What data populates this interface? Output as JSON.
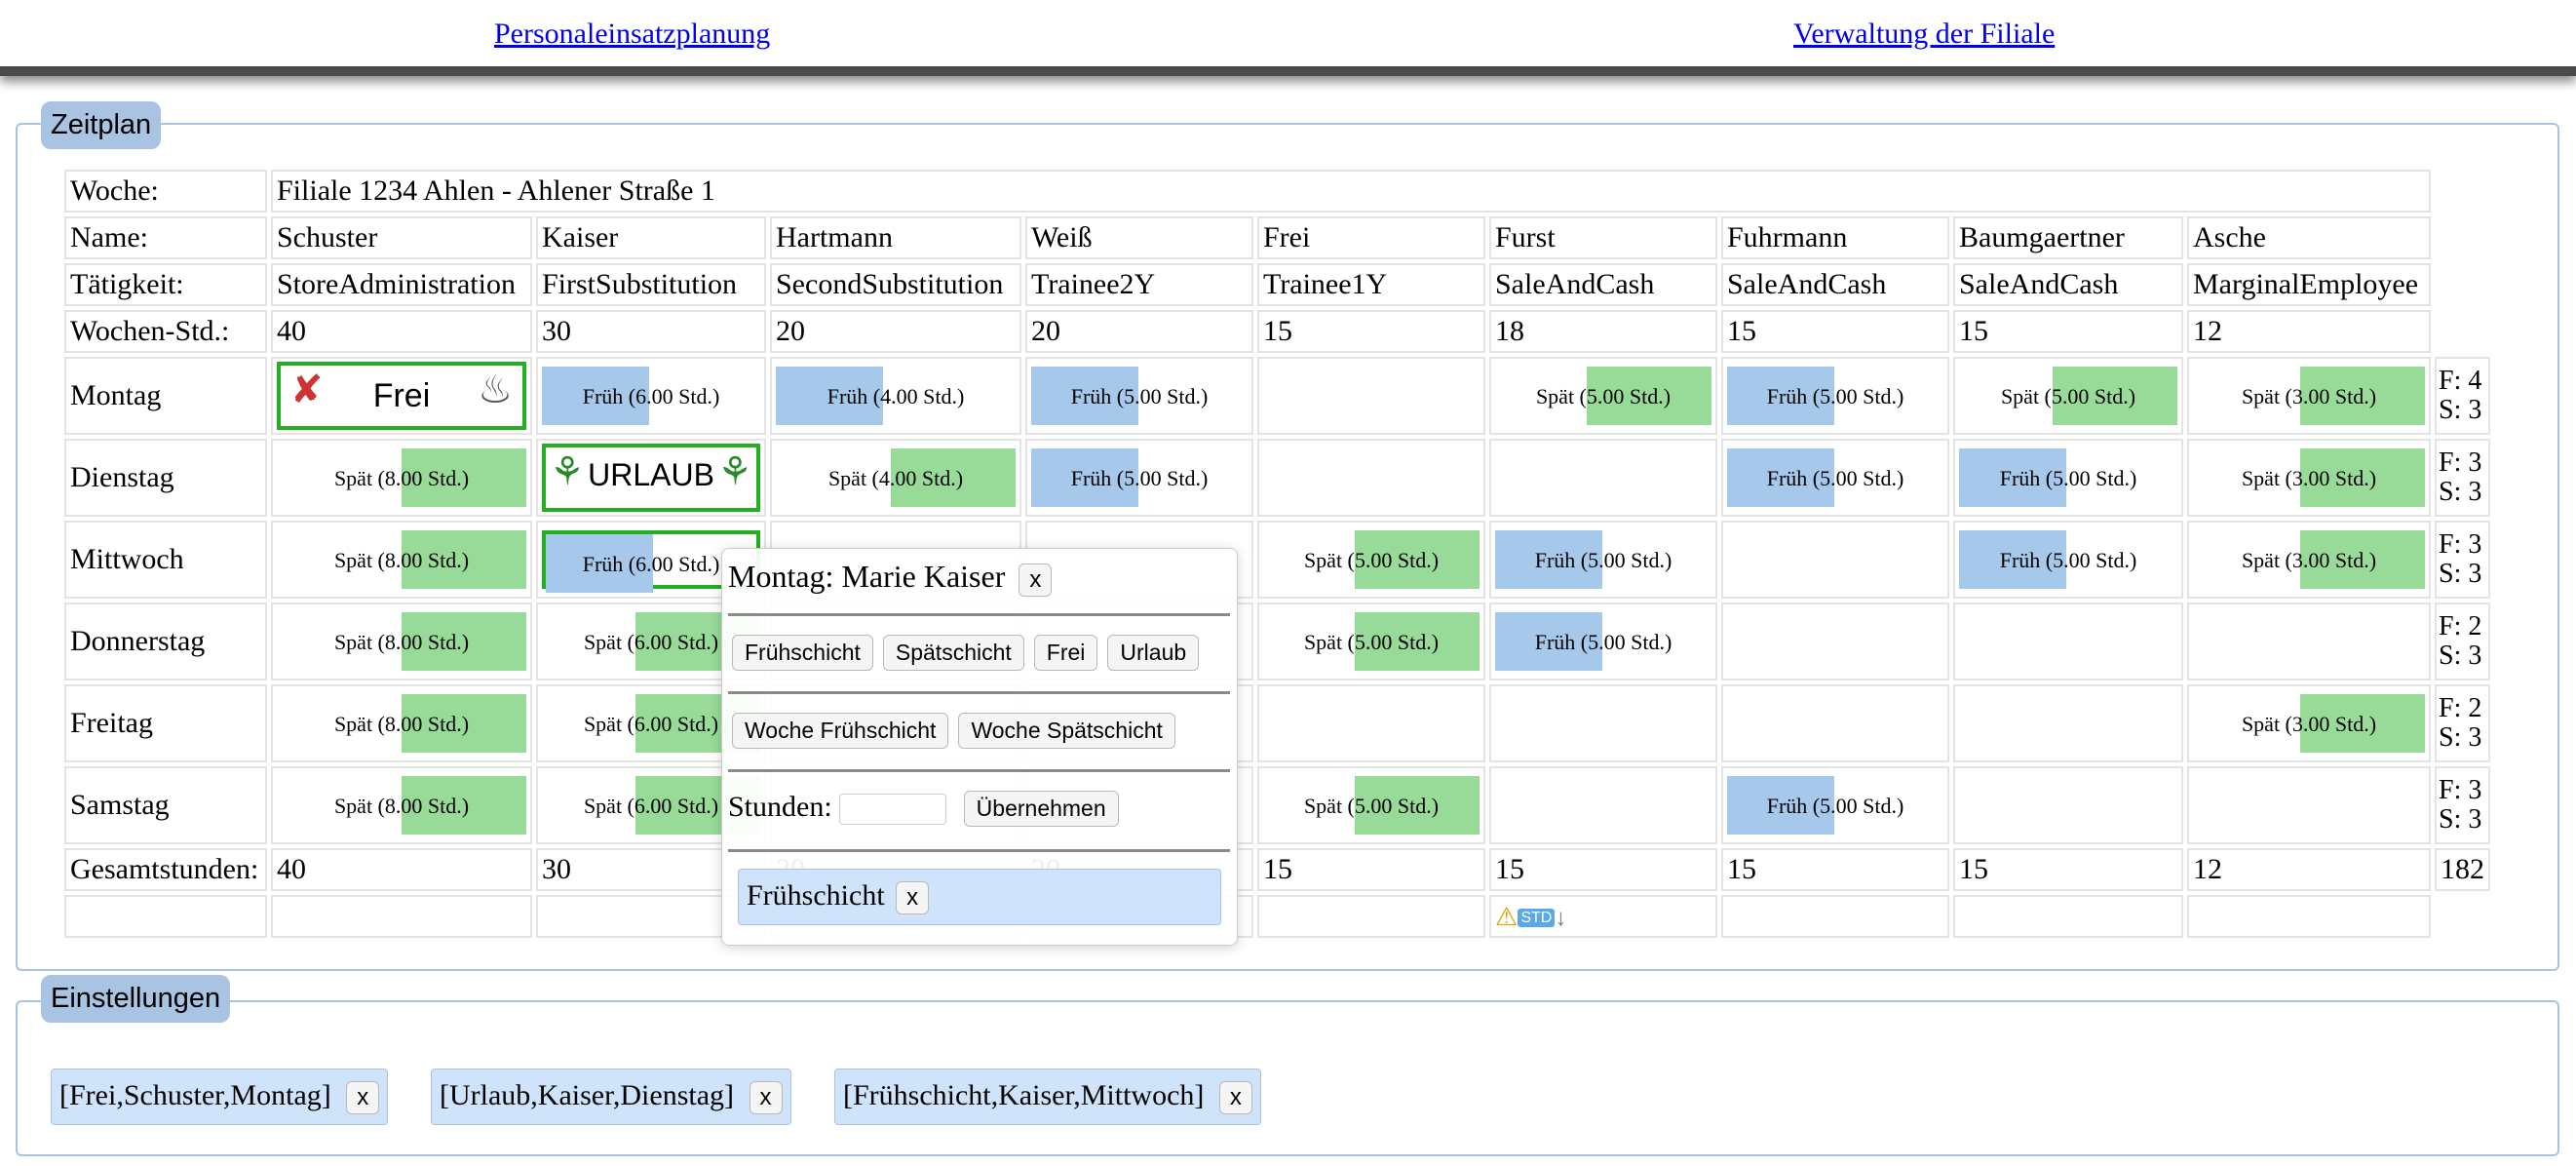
{
  "nav": {
    "link1": "Personaleinsatzplanung",
    "link2": "Verwaltung der Filiale"
  },
  "zeitplan": {
    "legend": "Zeitplan",
    "labels": {
      "woche": "Woche:",
      "name": "Name:",
      "taetigkeit": "Tätigkeit:",
      "wochenstd": "Wochen-Std.:",
      "gesamt": "Gesamtstunden:"
    },
    "week_value": "Filiale 1234 Ahlen - Ahlener Straße 1",
    "employees": [
      {
        "name": "Schuster",
        "role": "StoreAdministration",
        "hours": "40",
        "total": "40"
      },
      {
        "name": "Kaiser",
        "role": "FirstSubstitution",
        "hours": "30",
        "total": "30"
      },
      {
        "name": "Hartmann",
        "role": "SecondSubstitution",
        "hours": "20",
        "total": "20"
      },
      {
        "name": "Weiß",
        "role": "Trainee2Y",
        "hours": "20",
        "total": "20"
      },
      {
        "name": "Frei",
        "role": "Trainee1Y",
        "hours": "15",
        "total": "15"
      },
      {
        "name": "Furst",
        "role": "SaleAndCash",
        "hours": "18",
        "total": "15"
      },
      {
        "name": "Fuhrmann",
        "role": "SaleAndCash",
        "hours": "15",
        "total": "15"
      },
      {
        "name": "Baumgaertner",
        "role": "SaleAndCash",
        "hours": "15",
        "total": "15"
      },
      {
        "name": "Asche",
        "role": "MarginalEmployee",
        "hours": "12",
        "total": "12"
      }
    ],
    "grand_total": "182",
    "days": [
      {
        "name": "Montag",
        "count": [
          "F: 4",
          "S: 3"
        ],
        "cells": [
          {
            "t": "frei",
            "label": "Frei"
          },
          {
            "t": "early",
            "label": "Früh (6.00 Std.)"
          },
          {
            "t": "early",
            "label": "Früh (4.00 Std.)"
          },
          {
            "t": "early",
            "label": "Früh (5.00 Std.)"
          },
          {
            "t": ""
          },
          {
            "t": "late",
            "label": "Spät (5.00 Std.)"
          },
          {
            "t": "early",
            "label": "Früh (5.00 Std.)"
          },
          {
            "t": "late",
            "label": "Spät (5.00 Std.)"
          },
          {
            "t": "late",
            "label": "Spät (3.00 Std.)"
          }
        ]
      },
      {
        "name": "Dienstag",
        "count": [
          "F: 3",
          "S: 3"
        ],
        "cells": [
          {
            "t": "late",
            "label": "Spät (8.00 Std.)"
          },
          {
            "t": "urlaub",
            "label": "URLAUB"
          },
          {
            "t": "late",
            "label": "Spät (4.00 Std.)"
          },
          {
            "t": "early",
            "label": "Früh (5.00 Std.)"
          },
          {
            "t": ""
          },
          {
            "t": ""
          },
          {
            "t": "early",
            "label": "Früh (5.00 Std.)"
          },
          {
            "t": "early",
            "label": "Früh (5.00 Std.)"
          },
          {
            "t": "late",
            "label": "Spät (3.00 Std.)"
          }
        ]
      },
      {
        "name": "Mittwoch",
        "count": [
          "F: 3",
          "S: 3"
        ],
        "cells": [
          {
            "t": "late",
            "label": "Spät (8.00 Std.)"
          },
          {
            "t": "early-sel",
            "label": "Früh (6.00 Std.)"
          },
          {
            "t": ""
          },
          {
            "t": ""
          },
          {
            "t": "late",
            "label": "Spät (5.00 Std.)"
          },
          {
            "t": "early",
            "label": "Früh (5.00 Std.)"
          },
          {
            "t": ""
          },
          {
            "t": "early",
            "label": "Früh (5.00 Std.)"
          },
          {
            "t": "late",
            "label": "Spät (3.00 Std.)"
          }
        ]
      },
      {
        "name": "Donnerstag",
        "count": [
          "F: 2",
          "S: 3"
        ],
        "cells": [
          {
            "t": "late",
            "label": "Spät (8.00 Std.)"
          },
          {
            "t": "late",
            "label": "Spät (6.00 Std.)"
          },
          {
            "t": ""
          },
          {
            "t": ""
          },
          {
            "t": "late",
            "label": "Spät (5.00 Std.)"
          },
          {
            "t": "early",
            "label": "Früh (5.00 Std.)"
          },
          {
            "t": ""
          },
          {
            "t": ""
          },
          {
            "t": ""
          }
        ]
      },
      {
        "name": "Freitag",
        "count": [
          "F: 2",
          "S: 3"
        ],
        "cells": [
          {
            "t": "late",
            "label": "Spät (8.00 Std.)"
          },
          {
            "t": "late",
            "label": "Spät (6.00 Std.)"
          },
          {
            "t": ""
          },
          {
            "t": ""
          },
          {
            "t": ""
          },
          {
            "t": ""
          },
          {
            "t": ""
          },
          {
            "t": ""
          },
          {
            "t": "late",
            "label": "Spät (3.00 Std.)"
          }
        ]
      },
      {
        "name": "Samstag",
        "count": [
          "F: 3",
          "S: 3"
        ],
        "cells": [
          {
            "t": "late",
            "label": "Spät (8.00 Std.)"
          },
          {
            "t": "late",
            "label": "Spät (6.00 Std.)"
          },
          {
            "t": ""
          },
          {
            "t": ""
          },
          {
            "t": "late",
            "label": "Spät (5.00 Std.)"
          },
          {
            "t": ""
          },
          {
            "t": "early",
            "label": "Früh (5.00 Std.)"
          },
          {
            "t": ""
          },
          {
            "t": ""
          }
        ]
      }
    ],
    "warning_badge": "STD"
  },
  "popup": {
    "title": "Montag: Marie Kaiser",
    "close": "x",
    "buttons": [
      "Frühschicht",
      "Spätschicht",
      "Frei",
      "Urlaub"
    ],
    "week_buttons": [
      "Woche Frühschicht",
      "Woche Spätschicht"
    ],
    "stunden_label": "Stunden:",
    "stunden_value": "",
    "apply": "Übernehmen",
    "chip_label": "Frühschicht",
    "chip_close": "x"
  },
  "einstellungen": {
    "legend": "Einstellungen",
    "chips": [
      {
        "label": "[Frei,Schuster,Montag]",
        "close": "x"
      },
      {
        "label": "[Urlaub,Kaiser,Dienstag]",
        "close": "x"
      },
      {
        "label": "[Frühschicht,Kaiser,Mittwoch]",
        "close": "x"
      }
    ]
  }
}
